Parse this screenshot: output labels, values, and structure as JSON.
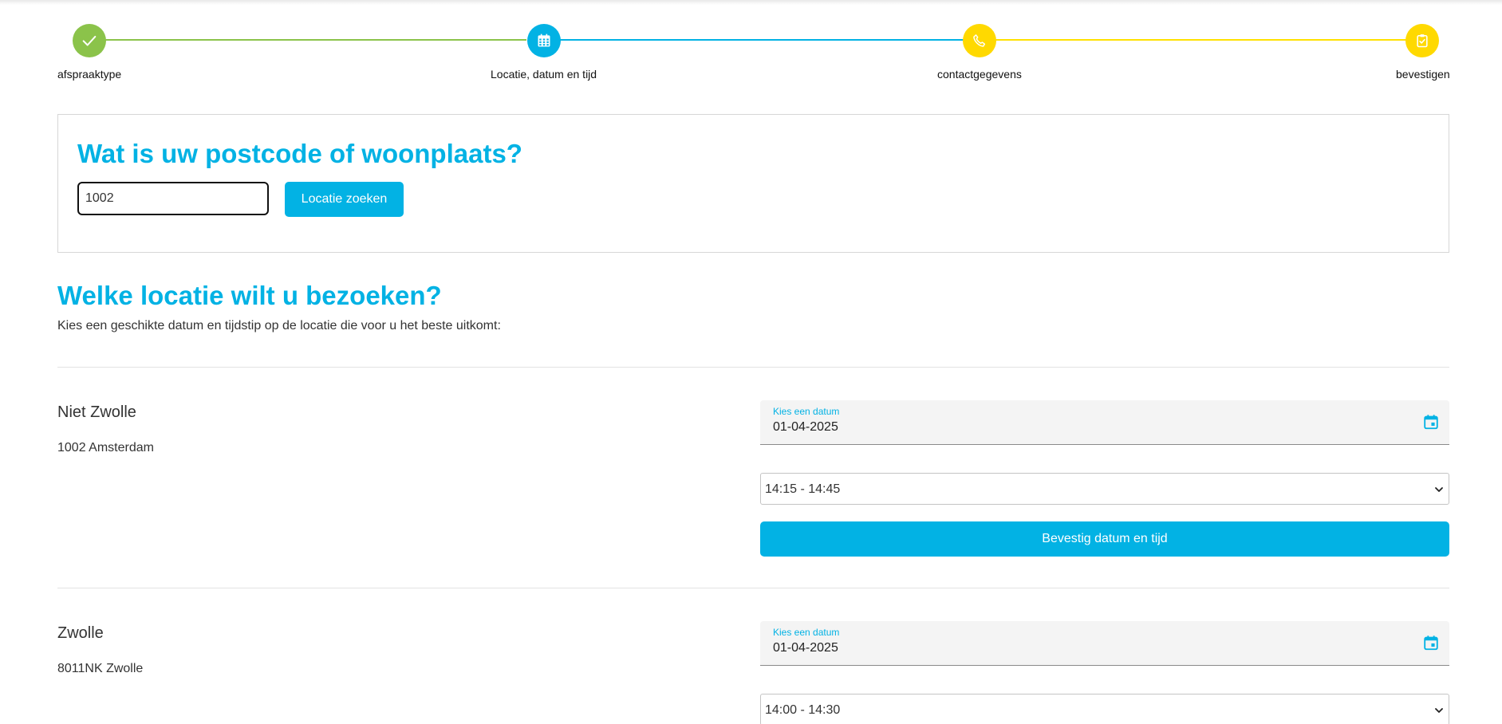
{
  "stepper": {
    "steps": [
      {
        "label": "afspraaktype",
        "status": "done",
        "icon": "check-icon",
        "color": "#8bc34a"
      },
      {
        "label": "Locatie, datum en tijd",
        "status": "current",
        "icon": "calendar-icon",
        "color": "#02b2e4"
      },
      {
        "label": "contactgegevens",
        "status": "upcoming",
        "icon": "phone-icon",
        "color": "#ffd900"
      },
      {
        "label": "bevestigen",
        "status": "upcoming",
        "icon": "clipboard-check-icon",
        "color": "#ffd900"
      }
    ]
  },
  "search": {
    "title": "Wat is uw postcode of woonplaats?",
    "input_value": "1002",
    "button_label": "Locatie zoeken"
  },
  "locations_section": {
    "title": "Welke locatie wilt u bezoeken?",
    "subtitle": "Kies een geschikte datum en tijdstip op de locatie die voor u het beste uitkomt:"
  },
  "locations": [
    {
      "name": "Niet Zwolle",
      "address": "1002 Amsterdam",
      "date_label": "Kies een datum",
      "date_value": "01-04-2025",
      "time_value": "14:15 - 14:45",
      "confirm_label": "Bevestig datum en tijd"
    },
    {
      "name": "Zwolle",
      "address": "8011NK Zwolle",
      "date_label": "Kies een datum",
      "date_value": "01-04-2025",
      "time_value": "14:00 - 14:30"
    }
  ],
  "colors": {
    "accent": "#02b2e4",
    "done": "#8bc34a",
    "upcoming": "#ffd900"
  }
}
